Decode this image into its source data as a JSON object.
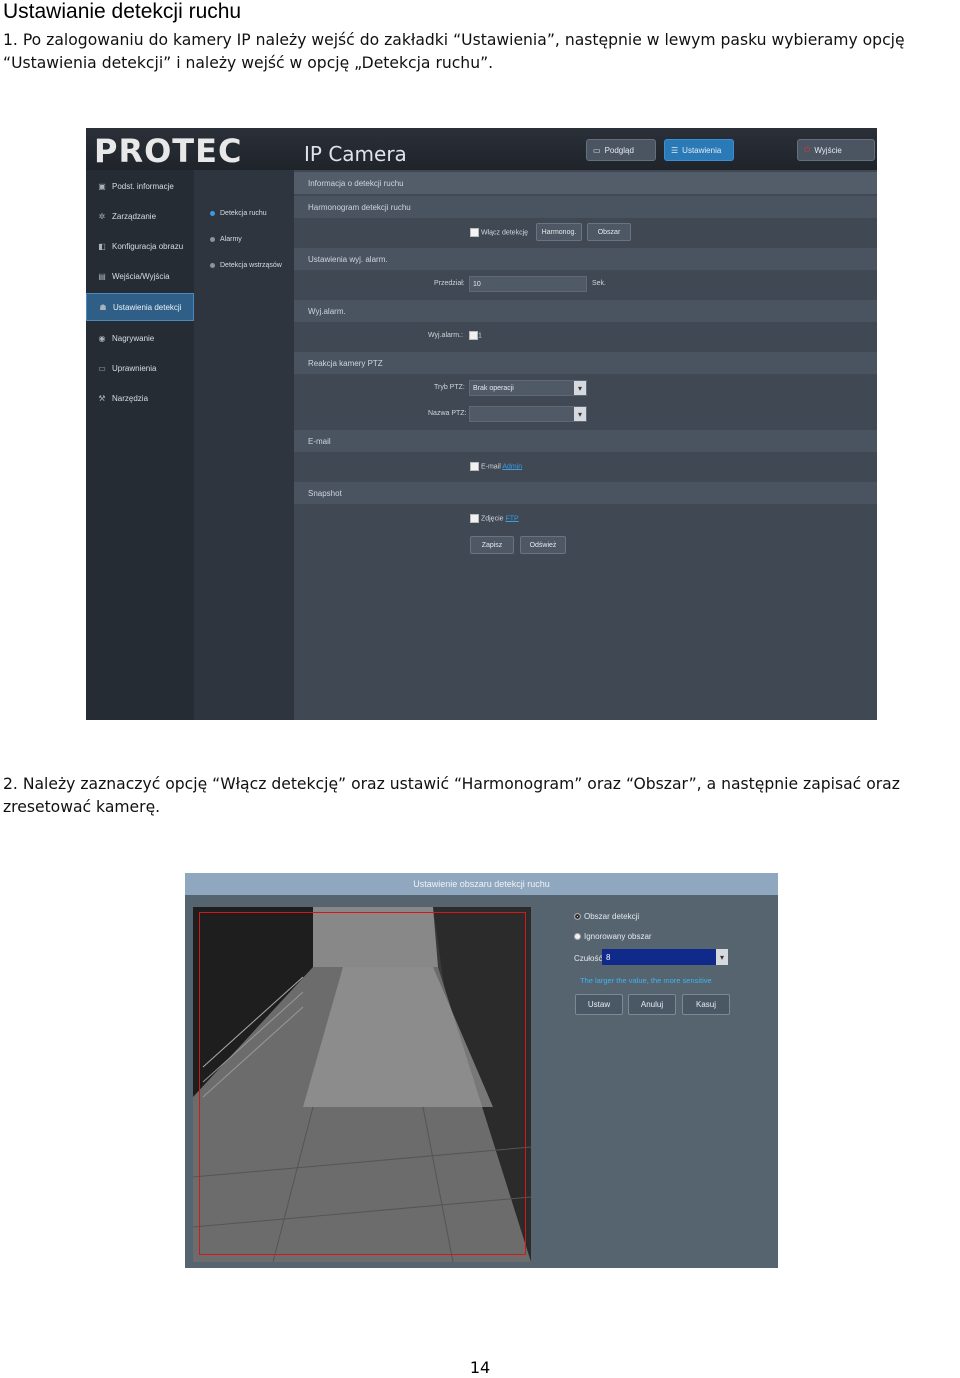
{
  "doc": {
    "title": "Ustawianie detekcji ruchu",
    "step1": "1. Po zalogowaniu do kamery IP należy wejść do zakładki “Ustawienia”, następnie w lewym pasku wybieramy opcję “Ustawienia detekcji” i należy wejść w opcję „Detekcja ruchu”.",
    "step2": "2. Należy zaznaczyć opcję “Włącz detekcję” oraz ustawić “Harmonogram” oraz “Obszar”, a następnie zapisać oraz zresetować kamerę.",
    "page_number": "14"
  },
  "screenshot1": {
    "logo": "PROTEC",
    "logo_subtitle": "IP Camera",
    "header_buttons": [
      "Podgląd",
      "Ustawienia",
      "Wyjście"
    ],
    "sidebar": [
      {
        "label": "Podst. informacje",
        "icon": "camera-icon",
        "glyph": "▣"
      },
      {
        "label": "Zarządzanie",
        "icon": "gear-icon",
        "glyph": "✲"
      },
      {
        "label": "Konfiguracja obrazu",
        "icon": "image-icon",
        "glyph": "◧"
      },
      {
        "label": "Wejścia/Wyjścia",
        "icon": "io-icon",
        "glyph": "▤"
      },
      {
        "label": "Ustawienia detekcji",
        "icon": "person-icon",
        "glyph": "☗"
      },
      {
        "label": "Nagrywanie",
        "icon": "record-icon",
        "glyph": "◉"
      },
      {
        "label": "Uprawnienia",
        "icon": "monitor-icon",
        "glyph": "▭"
      },
      {
        "label": "Narzędzia",
        "icon": "wrench-icon",
        "glyph": "⚒"
      }
    ],
    "sub_menu": [
      "Detekcja ruchu",
      "Alarmy",
      "Detekcja wstrząsów"
    ],
    "sections": {
      "info": "Informacja o detekcji ruchu",
      "schedule": "Harmonogram detekcji ruchu",
      "alarm_settings": "Ustawienia wyj. alarm.",
      "alarm_out": "Wyj.alarm.",
      "ptz": "Reakcja kamery PTZ",
      "email": "E-mail",
      "snapshot": "Snapshot"
    },
    "enable_label": "Włącz detekcję",
    "schedule_button": "Harmonog.",
    "area_button": "Obszar",
    "interval_label": "Przedział:",
    "interval_value": "10",
    "interval_unit": "Sek.",
    "alarm_out_label": "Wyj.alarm.:",
    "alarm_out_value": "1",
    "ptz_mode_label": "Tryb PTZ:",
    "ptz_mode_value": "Brak operacji",
    "ptz_name_label": "Nazwa PTZ:",
    "ptz_name_value": "",
    "email_label": "E-mail",
    "email_link": "Admin",
    "photo_label": "Zdjęcie",
    "photo_link": "FTP",
    "save_button": "Zapisz",
    "refresh_button": "Odśwież"
  },
  "screenshot2": {
    "title": "Ustawienie obszaru detekcji ruchu",
    "options": [
      "Obszar detekcji",
      "Ignorowany obszar"
    ],
    "sensitivity_label": "Czułość",
    "sensitivity_value": "8",
    "hint": "The larger the value, the more sensitive",
    "buttons": [
      "Ustaw",
      "Anuluj",
      "Kasuj"
    ]
  }
}
